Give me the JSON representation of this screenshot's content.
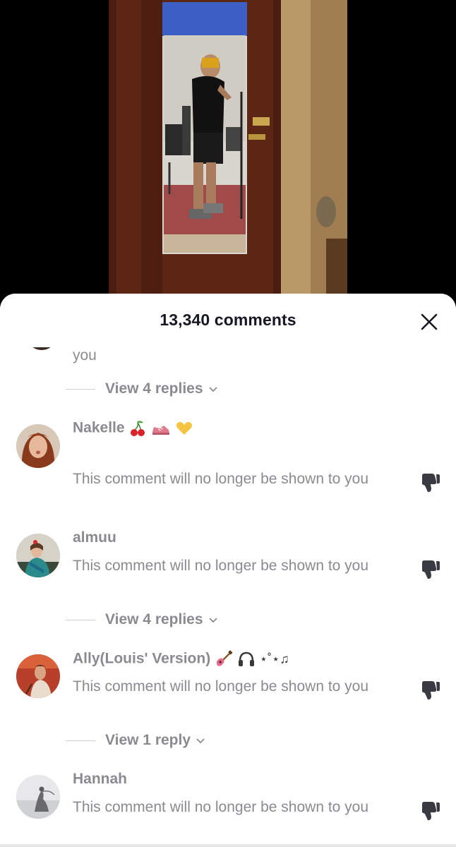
{
  "header": {
    "title": "13,340 comments",
    "close_icon": "close-icon"
  },
  "comments": [
    {
      "username": "",
      "text": "you",
      "replies_label": "View 4 replies"
    },
    {
      "username": "Nakelle",
      "username_emojis": [
        "cherry-emoji",
        "sneaker-emoji",
        "yellow-heart-emoji"
      ],
      "text": "This comment will no longer be shown to you",
      "dislike_icon": "thumbs-down-icon"
    },
    {
      "username": "almuu",
      "text": "This comment will no longer be shown to you",
      "dislike_icon": "thumbs-down-icon",
      "replies_label": "View 4 replies"
    },
    {
      "username": "Ally(Louis' Version)",
      "username_suffix": "⋆˚⋆♫",
      "username_emojis": [
        "guitar-emoji",
        "headphones-emoji"
      ],
      "text": "This comment will no longer be shown to you",
      "dislike_icon": "thumbs-down-icon",
      "replies_label": "View 1 reply"
    },
    {
      "username": "Hannah",
      "text": "This comment will no longer be shown to you",
      "dislike_icon": "thumbs-down-icon"
    }
  ],
  "colors": {
    "title": "#161823",
    "muted_text": "#8a8b91",
    "sheet_bg": "#ffffff",
    "video_bg": "#000000"
  }
}
